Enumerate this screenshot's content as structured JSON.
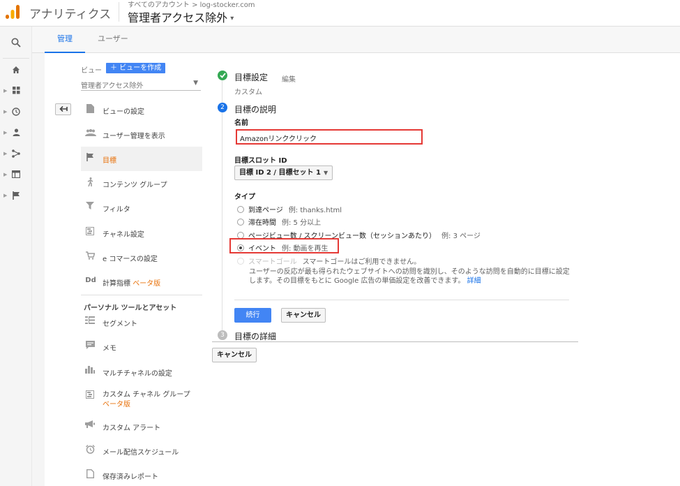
{
  "header": {
    "app_title": "アナリティクス",
    "account_line": "すべてのアカウント > log-stocker.com",
    "view_title": "管理者アクセス除外",
    "view_caret": "▾"
  },
  "tabs": {
    "admin": "管理",
    "user": "ユーザー"
  },
  "nav": {
    "view_label": "ビュー",
    "create_view": "＋ ビューを作成",
    "view_select": "管理者アクセス除外",
    "items": [
      {
        "label": "ビューの設定"
      },
      {
        "label": "ユーザー管理を表示"
      },
      {
        "label": "目標"
      },
      {
        "label": "コンテンツ グループ"
      },
      {
        "label": "フィルタ"
      },
      {
        "label": "チャネル設定"
      },
      {
        "label": "e コマースの設定"
      },
      {
        "label": "計算指標",
        "beta": "ベータ版"
      }
    ],
    "section_title": "パーソナル ツールとアセット",
    "personal_items": [
      {
        "label": "セグメント"
      },
      {
        "label": "メモ"
      },
      {
        "label": "マルチチャネルの設定"
      },
      {
        "label": "カスタム チャネル グループ",
        "beta": "ベータ版"
      },
      {
        "label": "カスタム アラート"
      },
      {
        "label": "メール配信スケジュール"
      },
      {
        "label": "保存済みレポート"
      }
    ]
  },
  "goal": {
    "step1_title": "目標設定",
    "step1_edit": "編集",
    "step1_sub": "カスタム",
    "step2_number": "2",
    "step2_title": "目標の説明",
    "name_label": "名前",
    "name_value": "Amazonリンククリック",
    "slot_label": "目標スロット ID",
    "slot_value": "目標 ID 2 / 目標セット 1",
    "type_label": "タイプ",
    "types": [
      {
        "label": "到達ページ",
        "example": "例: thanks.html"
      },
      {
        "label": "滞在時間",
        "example": "例: 5 分以上"
      },
      {
        "label": "ページビュー数 / スクリーンビュー数（セッションあたり）",
        "example": "例: 3 ページ"
      },
      {
        "label": "イベント",
        "example": "例: 動画を再生"
      },
      {
        "label": "スマートゴール",
        "example": "スマートゴールはご利用できません。"
      }
    ],
    "smart_desc": "ユーザーの反応が最も得られたウェブサイトへの訪問を識別し、そのような訪問を自動的に目標に設定します。その目標をもとに Google 広告の単価設定を改善できます。",
    "smart_link": "詳細",
    "continue": "続行",
    "cancel": "キャンセル",
    "step3_number": "3",
    "step3_title": "目標の詳細",
    "cancel_outer": "キャンセル"
  },
  "colors": {
    "accent": "#4285f4",
    "active_nav": "#e8710a",
    "highlight": "#e53935",
    "step_done": "#34a853"
  }
}
